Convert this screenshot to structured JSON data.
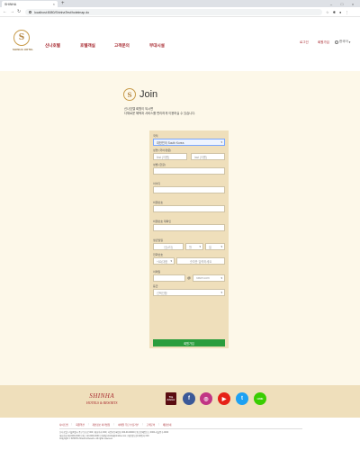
{
  "browser": {
    "tab_title": "SHINHA",
    "url": "localhost:8080/ShinhaTest/hotelmap.do"
  },
  "header": {
    "brand_text": "SHINHA HOTEL",
    "nav": [
      "신나호텔",
      "호텔객실",
      "고객문의",
      "부대시설"
    ],
    "util": [
      "로그인",
      "회원가입"
    ],
    "language": "한국어"
  },
  "join": {
    "title": "Join",
    "desc_line1": "신나호텔 회원이 되시면",
    "desc_line2": "다채로운 혜택과 서비스를 편리하게 이용하실 수 있습니다.",
    "fields": {
      "nationality_label": "국적",
      "nationality_value": "대한민국 South Korea",
      "name_label": "성명 (국어/영문)",
      "first_placeholder": "first (이름)",
      "last_placeholder": "last (이름)",
      "gender_label": "성별 (한글)",
      "id_label": "아이디",
      "password_label": "비밀번호",
      "password_confirm_label": "비밀번호 재확인",
      "birth_label": "생년월일",
      "birth_year": "년(4자)",
      "birth_month": "월",
      "birth_day": "일",
      "phone_label": "전화번호",
      "phone_code": "+82(대한",
      "phone_placeholder": "숫자만 입력하세요",
      "email_label": "이메일",
      "email_at": "@",
      "email_domain": "naver.com",
      "grade_label": "등급",
      "grade_value": "선택안함"
    },
    "submit_label": "회원가입"
  },
  "footer": {
    "brand_name": "SHINHA",
    "brand_sub": "HOTELS & RESORTS",
    "social": {
      "trip": "Trip Advisor",
      "facebook": "f",
      "instagram": "◎",
      "youtube": "▶",
      "twitter": "t",
      "line": "LINE"
    },
    "links": [
      "사이트맵",
      "회원약관",
      "개인정보 처리방침",
      "이메일 무단 수집거부",
      "고객문의",
      "채용안내"
    ],
    "info_lines": [
      "신나호텔 | 서울특별시 중구 동호로 000 | 대표이사 000 | 사업자등록번호 000-00-00000 | 통신판매업신고 0000-서울중구-0000",
      "대표전화 02-0000-0000 | 팩스 02-0000-0000 | 이메일 shinha@shinha.com | 개인정보관리책임자 000",
      "Copyright © SHINHA Hotels & Resorts. All rights reserved."
    ]
  },
  "colors": {
    "accent": "#a5242b",
    "gold": "#c89b4a",
    "form_bg": "#efdfbb",
    "page_bg": "#fdf8e9",
    "submit": "#2a9d3d",
    "facebook": "#3b5998",
    "instagram": "#c13584",
    "youtube": "#e62117",
    "twitter": "#1da1f2",
    "line": "#3acd01"
  }
}
